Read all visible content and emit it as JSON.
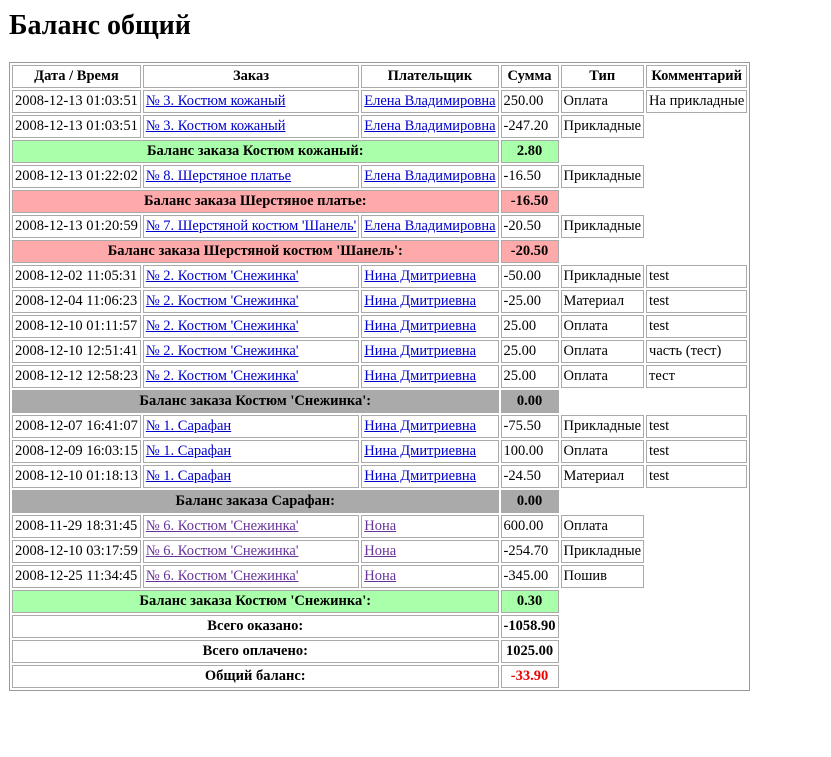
{
  "title": "Баланс общий",
  "headers": [
    "Дата / Время",
    "Заказ",
    "Плательщик",
    "Сумма",
    "Тип",
    "Комментарий"
  ],
  "rows": [
    {
      "kind": "tx",
      "date": "2008-12-13 01:03:51",
      "order": "№ 3. Костюм кожаный",
      "payer": "Елена Владимировна",
      "sum": "250.00",
      "type": "Оплата",
      "comment": "На прикладные"
    },
    {
      "kind": "tx",
      "date": "2008-12-13 01:03:51",
      "order": "№ 3. Костюм кожаный",
      "payer": "Елена Владимировна",
      "sum": "-247.20",
      "type": "Прикладные"
    },
    {
      "kind": "bal",
      "color": "green",
      "label": "Баланс заказа Костюм кожаный:",
      "sum": "2.80"
    },
    {
      "kind": "tx",
      "date": "2008-12-13 01:22:02",
      "order": "№ 8. Шерстяное платье",
      "payer": "Елена Владимировна",
      "sum": "-16.50",
      "type": "Прикладные"
    },
    {
      "kind": "bal",
      "color": "red",
      "label": "Баланс заказа Шерстяное платье:",
      "sum": "-16.50"
    },
    {
      "kind": "tx",
      "date": "2008-12-13 01:20:59",
      "order": "№ 7. Шерстяной костюм 'Шанель'",
      "payer": "Елена Владимировна",
      "sum": "-20.50",
      "type": "Прикладные"
    },
    {
      "kind": "bal",
      "color": "red",
      "label": "Баланс заказа Шерстяной костюм 'Шанель':",
      "sum": "-20.50"
    },
    {
      "kind": "tx",
      "date": "2008-12-02 11:05:31",
      "order": "№ 2. Костюм 'Снежинка'",
      "payer": "Нина Дмитриевна",
      "sum": "-50.00",
      "type": "Прикладные",
      "comment": "test"
    },
    {
      "kind": "tx",
      "date": "2008-12-04 11:06:23",
      "order": "№ 2. Костюм 'Снежинка'",
      "payer": "Нина Дмитриевна",
      "sum": "-25.00",
      "type": "Материал",
      "comment": "test"
    },
    {
      "kind": "tx",
      "date": "2008-12-10 01:11:57",
      "order": "№ 2. Костюм 'Снежинка'",
      "payer": "Нина Дмитриевна",
      "sum": "25.00",
      "type": "Оплата",
      "comment": "test"
    },
    {
      "kind": "tx",
      "date": "2008-12-10 12:51:41",
      "order": "№ 2. Костюм 'Снежинка'",
      "payer": "Нина Дмитриевна",
      "sum": "25.00",
      "type": "Оплата",
      "comment": "часть (тест)"
    },
    {
      "kind": "tx",
      "date": "2008-12-12 12:58:23",
      "order": "№ 2. Костюм 'Снежинка'",
      "payer": "Нина Дмитриевна",
      "sum": "25.00",
      "type": "Оплата",
      "comment": "тест"
    },
    {
      "kind": "bal",
      "color": "gray",
      "label": "Баланс заказа Костюм 'Снежинка':",
      "sum": "0.00"
    },
    {
      "kind": "tx",
      "date": "2008-12-07 16:41:07",
      "order": "№ 1. Сарафан",
      "payer": "Нина Дмитриевна",
      "sum": "-75.50",
      "type": "Прикладные",
      "comment": "test"
    },
    {
      "kind": "tx",
      "date": "2008-12-09 16:03:15",
      "order": "№ 1. Сарафан",
      "payer": "Нина Дмитриевна",
      "sum": "100.00",
      "type": "Оплата",
      "comment": "test"
    },
    {
      "kind": "tx",
      "date": "2008-12-10 01:18:13",
      "order": "№ 1. Сарафан",
      "payer": "Нина Дмитриевна",
      "sum": "-24.50",
      "type": "Материал",
      "comment": "test"
    },
    {
      "kind": "bal",
      "color": "gray",
      "label": "Баланс заказа Сарафан:",
      "sum": "0.00"
    },
    {
      "kind": "tx",
      "visited": true,
      "date": "2008-11-29 18:31:45",
      "order": "№ 6. Костюм 'Снежинка'",
      "payer": "Нона",
      "sum": "600.00",
      "type": "Оплата"
    },
    {
      "kind": "tx",
      "visited": true,
      "date": "2008-12-10 03:17:59",
      "order": "№ 6. Костюм 'Снежинка'",
      "payer": "Нона",
      "sum": "-254.70",
      "type": "Прикладные"
    },
    {
      "kind": "tx",
      "visited": true,
      "date": "2008-12-25 11:34:45",
      "order": "№ 6. Костюм 'Снежинка'",
      "payer": "Нона",
      "sum": "-345.00",
      "type": "Пошив"
    },
    {
      "kind": "bal",
      "color": "green",
      "label": "Баланс заказа Костюм 'Снежинка':",
      "sum": "0.30"
    },
    {
      "kind": "total",
      "label": "Всего оказано:",
      "sum": "-1058.90"
    },
    {
      "kind": "total",
      "label": "Всего оплачено:",
      "sum": "1025.00"
    },
    {
      "kind": "total",
      "label": "Общий баланс:",
      "sum": "-33.90",
      "red": true
    }
  ],
  "colors": {
    "green": "#aaffaa",
    "red": "#ffaaaa",
    "gray": "#aaaaaa",
    "link": "#0000cc",
    "visited": "#663399",
    "negative": "#ee0000"
  }
}
